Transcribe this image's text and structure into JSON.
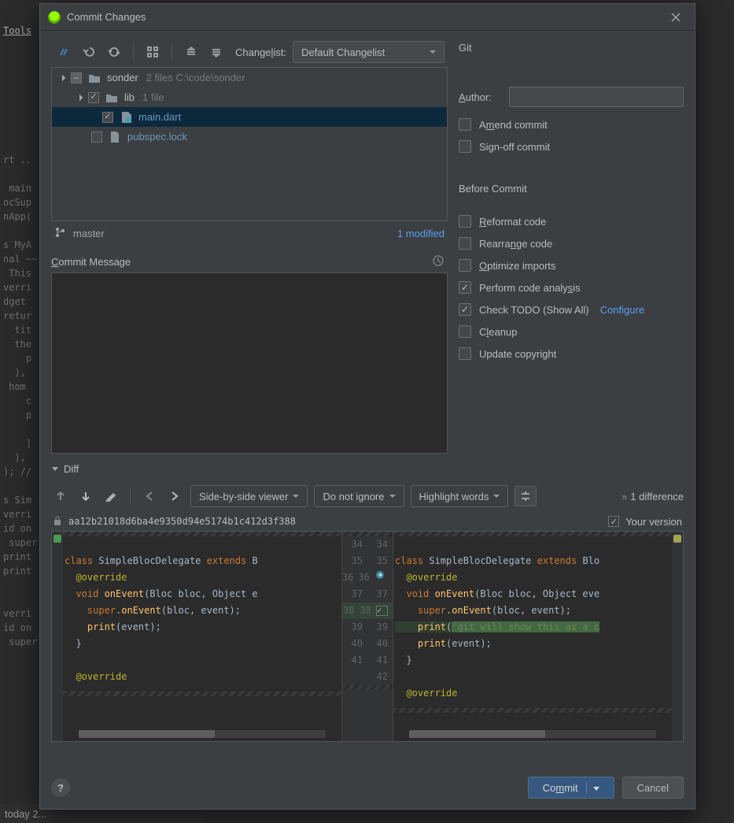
{
  "editor_bg": {
    "menu": "Tools",
    "lines": "rt ..\n\n main\nocSup\nnApp(\n\ns MyA\nnal ~~\n This\nverri\ndget\nretur\n  tit\n  the\n    p\n  ),\n hom\n    c\n    p\n\n    ]\n  ),\n); //\n\ns Sim\nverri\nid on\n super\nprint\nprint\n\n\nverri\nid on\n super"
  },
  "dialog": {
    "title": "Commit Changes",
    "changelist_label_pre": "Change",
    "changelist_label_u": "l",
    "changelist_label_post": "ist:",
    "changelist_value": "Default Changelist",
    "tree": {
      "root_name": "sonder",
      "root_meta": "2 files  C:\\code\\sonder",
      "lib_name": "lib",
      "lib_meta": "1 file",
      "file1": "main.dart",
      "file2": "pubspec.lock"
    },
    "branch": "master",
    "modified": "1 modified",
    "commit_msg_u": "C",
    "commit_msg_rest": "ommit Message"
  },
  "right": {
    "git": "Git",
    "author_u": "A",
    "author_rest": "uthor:",
    "amend_pre": "A",
    "amend_u": "m",
    "amend_post": "end commit",
    "signoff_pre": "Si",
    "signoff_u": "g",
    "signoff_post": "n-off commit",
    "before": "Before Commit",
    "reformat_u": "R",
    "reformat_rest": "eformat code",
    "rearrange_pre": "Rearra",
    "rearrange_u": "n",
    "rearrange_post": "ge code",
    "optimize_u": "O",
    "optimize_rest": "ptimize imports",
    "analysis_pre": "Perform code analy",
    "analysis_u": "s",
    "analysis_post": "is",
    "todo": "Check TODO (Show All)",
    "configure": "Configure",
    "cleanup_pre": "C",
    "cleanup_u": "l",
    "cleanup_post": "eanup",
    "copyright": "Update copyright"
  },
  "diff": {
    "label": "Diff",
    "viewmode": "Side-by-side viewer",
    "ignoremode": "Do not ignore",
    "hlmode": "Highlight words",
    "diffcount": "1 difference",
    "hash": "aa12b21018d6ba4e9350d94e5174b1c412d3f388",
    "yourversion": "Your version",
    "left_lines": [
      {
        "t": "class ",
        "c": "kw"
      },
      {
        "t": "SimpleBlocDelegate ",
        "c": ""
      },
      {
        "t": "extends ",
        "c": "kw"
      },
      {
        "t": "B",
        "c": ""
      }
    ],
    "gutter_left": [
      "34",
      "35",
      "36",
      "37",
      "38",
      "39",
      "40",
      "41"
    ],
    "gutter_right": [
      "34",
      "35",
      "36",
      "37",
      "38",
      "39",
      "40",
      "41",
      "42"
    ]
  },
  "footer": {
    "commit_pre": "Co",
    "commit_u": "m",
    "commit_post": "mit",
    "cancel": "Cancel"
  },
  "status": "today 2..."
}
